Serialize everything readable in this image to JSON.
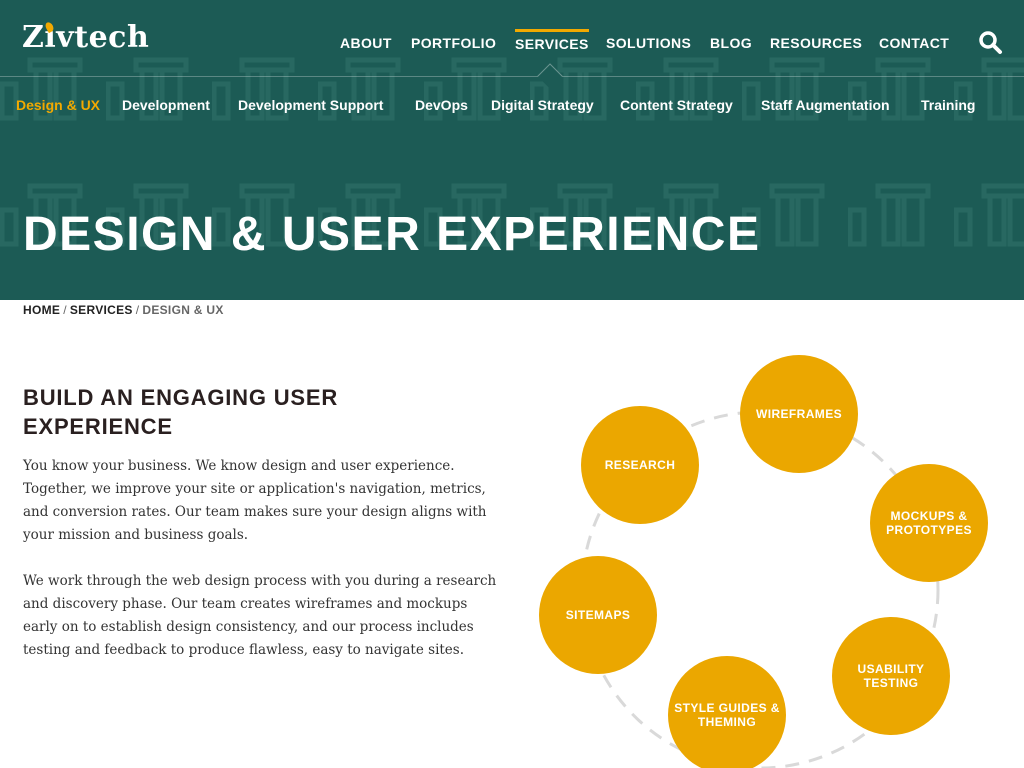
{
  "brand": {
    "logo_text": "Zivtech",
    "accent_color": "#f2a900",
    "hero_bg_color": "#1c5b55",
    "circle_color": "#eba700"
  },
  "main_nav": {
    "items": [
      {
        "label": "ABOUT"
      },
      {
        "label": "PORTFOLIO"
      },
      {
        "label": "SERVICES",
        "active": true
      },
      {
        "label": "SOLUTIONS"
      },
      {
        "label": "BLOG"
      },
      {
        "label": "RESOURCES"
      },
      {
        "label": "CONTACT"
      }
    ],
    "search_icon": "search-icon"
  },
  "sub_nav": {
    "items": [
      {
        "label": "Design & UX",
        "active": true
      },
      {
        "label": "Development"
      },
      {
        "label": "Development Support"
      },
      {
        "label": "DevOps"
      },
      {
        "label": "Digital Strategy"
      },
      {
        "label": "Content Strategy"
      },
      {
        "label": "Staff Augmentation"
      },
      {
        "label": "Training"
      }
    ]
  },
  "hero": {
    "title": "DESIGN & USER EXPERIENCE"
  },
  "breadcrumb": {
    "home": "HOME",
    "services": "SERVICES",
    "separator": "/",
    "current": "DESIGN & UX"
  },
  "content": {
    "heading": "BUILD AN ENGAGING USER EXPERIENCE",
    "paragraph_1": "You know your business. We know design and user experience. Together, we improve your site or application's navigation, metrics, and conversion rates. Our team makes sure your design aligns with your mission and business goals.",
    "paragraph_2": "We work through the web design process with you during a research and discovery phase. Our team creates wireframes and mockups early on to establish design consistency, and our process includes testing and feedback to produce flawless, easy to navigate sites."
  },
  "process_diagram": {
    "steps": [
      {
        "label": "RESEARCH"
      },
      {
        "label": "WIREFRAMES"
      },
      {
        "label": "MOCKUPS & PROTOTYPES"
      },
      {
        "label": "USABILITY TESTING"
      },
      {
        "label": "STYLE GUIDES & THEMING"
      },
      {
        "label": "SITEMAPS"
      }
    ]
  }
}
